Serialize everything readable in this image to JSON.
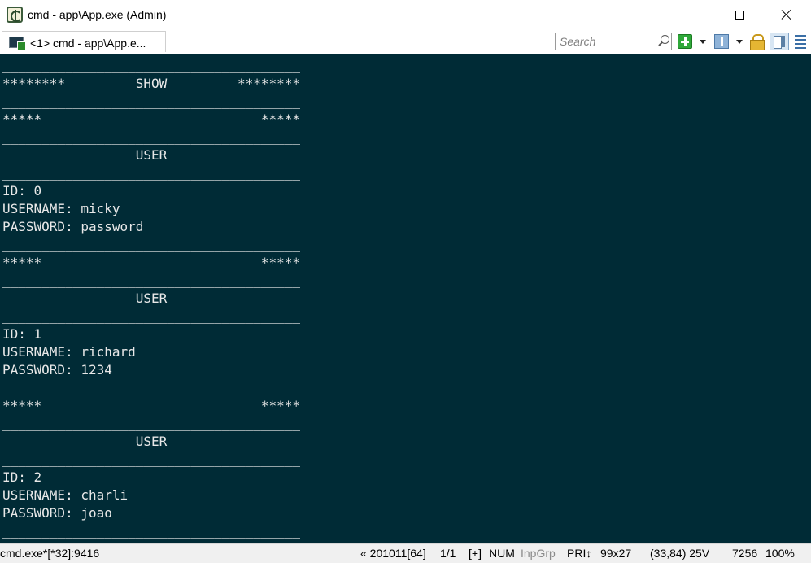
{
  "window": {
    "title": "cmd - app\\App.exe (Admin)"
  },
  "tab": {
    "label": "<1> cmd - app\\App.e..."
  },
  "toolbar": {
    "search_placeholder": "Search"
  },
  "console": {
    "lines": [
      "______________________________________",
      "********         SHOW         ********",
      "______________________________________",
      "*****                            *****",
      "______________________________________",
      "                 USER",
      "______________________________________",
      "ID: 0",
      "USERNAME: micky",
      "PASSWORD: password",
      "______________________________________",
      "*****                            *****",
      "______________________________________",
      "                 USER",
      "______________________________________",
      "ID: 1",
      "USERNAME: richard",
      "PASSWORD: 1234",
      "______________________________________",
      "*****                            *****",
      "______________________________________",
      "                 USER",
      "______________________________________",
      "ID: 2",
      "USERNAME: charli",
      "PASSWORD: joao",
      "______________________________________"
    ]
  },
  "statusbar": {
    "process": "cmd.exe*[*32]:9416",
    "build": "« 201011[64]",
    "page": "1/1",
    "mode": "[+]",
    "num": "NUM",
    "inpgrp": "InpGrp",
    "pri": "PRI↕",
    "size": "99x27",
    "cursor": "(33,84) 25V",
    "count": "7256",
    "zoom": "100%"
  },
  "colors": {
    "console_bg": "#002b36",
    "console_fg": "#e8e8e8",
    "statusbar_bg": "#f0f0f0"
  }
}
